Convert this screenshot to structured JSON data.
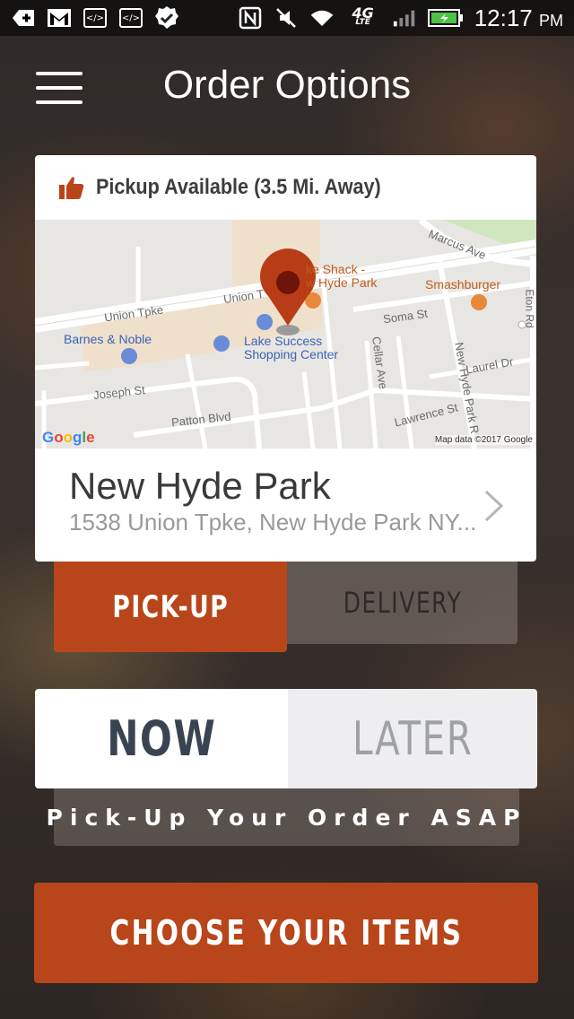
{
  "status_bar": {
    "icons": [
      "add-icon",
      "gmail-icon",
      "code-icon",
      "code-icon",
      "check-badge-icon",
      "nfc-icon",
      "mute-icon",
      "wifi-icon",
      "lte-icon",
      "signal-icon",
      "battery-icon"
    ],
    "network": "4G",
    "network_sub": "LTE",
    "time": "12:17",
    "ampm": "PM"
  },
  "header": {
    "title": "Order Options",
    "menu_icon": "hamburger-menu-icon"
  },
  "location_card": {
    "pickup_status": "Pickup Available (3.5 Mi. Away)",
    "status_icon": "thumbs-up-icon",
    "map": {
      "labels": {
        "marcus": "Marcus Ave",
        "union1": "Union Tpke",
        "union2": "Union T",
        "shack": "ke Shack -",
        "shack2": "w Hyde Park",
        "smash": "Smashburger",
        "eton": "Eton Rd",
        "barnes": "Barnes & Noble",
        "lake1": "Lake Success",
        "lake2": "Shopping Center",
        "soma": "Soma St",
        "cellar": "Cellar Ave",
        "nhpr": "New Hyde Park R",
        "laurel": "Laurel Dr",
        "joseph": "Joseph St",
        "patton": "Patton Blvd",
        "lawrence": "Lawrence St"
      },
      "google_logo": "Google",
      "attribution": "Map data ©2017 Google"
    },
    "store_name": "New Hyde Park",
    "address": "1538 Union Tpke, New Hyde Park NY..."
  },
  "order_type": {
    "pickup_label": "PICK-UP",
    "delivery_label": "DELIVERY",
    "selected": "PICK-UP"
  },
  "timing": {
    "now_label": "NOW",
    "later_label": "LATER",
    "selected": "NOW",
    "note": "Pick-Up Your Order ASAP"
  },
  "cta": {
    "label": "CHOOSE YOUR ITEMS"
  },
  "colors": {
    "accent": "#b8461a",
    "pin": "#b83c16",
    "map_bg": "#e8e6e2"
  }
}
